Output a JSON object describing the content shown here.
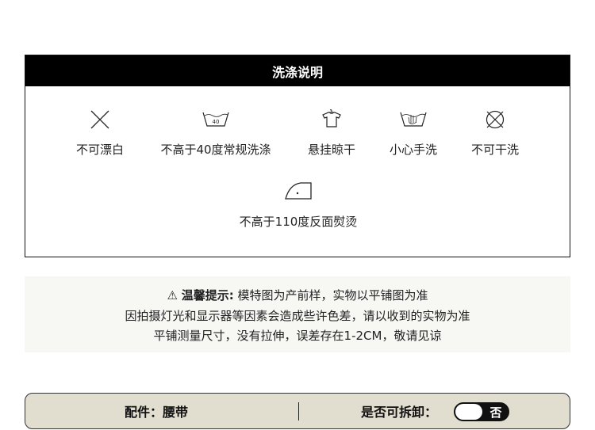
{
  "care": {
    "title": "洗涤说明",
    "items": [
      {
        "label": "不可漂白",
        "icon": "no-bleach-icon"
      },
      {
        "label": "不高于40度常规洗涤",
        "icon": "wash-40-icon",
        "icon_text": "40"
      },
      {
        "label": "悬挂晾干",
        "icon": "hang-dry-icon"
      },
      {
        "label": "小心手洗",
        "icon": "hand-wash-icon"
      },
      {
        "label": "不可干洗",
        "icon": "no-dry-clean-icon"
      },
      {
        "label": "不高于110度反面熨烫",
        "icon": "iron-110-icon"
      }
    ]
  },
  "notice": {
    "warning_icon": "⚠",
    "title": "温馨提示:",
    "lines": [
      "模特图为产前样，实物以平铺图为准",
      "因拍摄灯光和显示器等因素会造成些许色差，请以收到的实物为准",
      "平铺测量尺寸，没有拉伸，误差存在1-2CM，敬请见谅"
    ]
  },
  "accessory": {
    "label": "配件：腰带",
    "removable_label": "是否可拆卸：",
    "removable_value": "否"
  },
  "colors": {
    "header_bg": "#000000",
    "notice_bg": "#f7f7f4",
    "bar_bg": "#e1ddcf"
  }
}
